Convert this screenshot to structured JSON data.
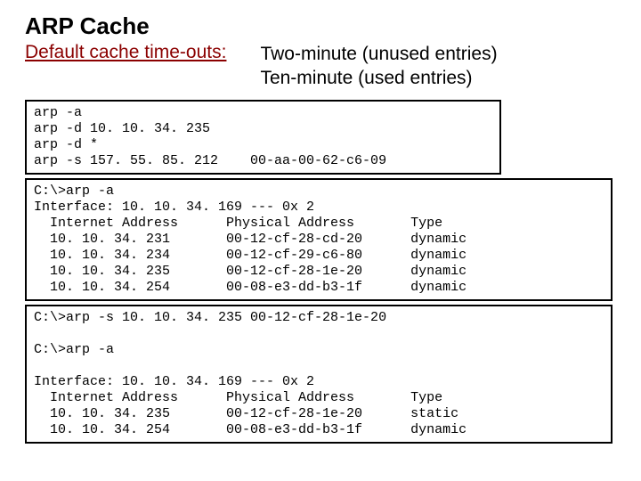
{
  "title": "ARP Cache",
  "subhead": "Default cache time-outs:",
  "timeouts": {
    "line1": "Two-minute (unused entries)",
    "line2": "Ten-minute (used entries)"
  },
  "block1": "arp -a\narp -d 10. 10. 34. 235\narp -d *\narp -s 157. 55. 85. 212    00-aa-00-62-c6-09",
  "block2": "C:\\>arp -a\nInterface: 10. 10. 34. 169 --- 0x 2\n  Internet Address      Physical Address       Type\n  10. 10. 34. 231       00-12-cf-28-cd-20      dynamic\n  10. 10. 34. 234       00-12-cf-29-c6-80      dynamic\n  10. 10. 34. 235       00-12-cf-28-1e-20      dynamic\n  10. 10. 34. 254       00-08-e3-dd-b3-1f      dynamic",
  "block3": "C:\\>arp -s 10. 10. 34. 235 00-12-cf-28-1e-20\n\nC:\\>arp -a\n\nInterface: 10. 10. 34. 169 --- 0x 2\n  Internet Address      Physical Address       Type\n  10. 10. 34. 235       00-12-cf-28-1e-20      static\n  10. 10. 34. 254       00-08-e3-dd-b3-1f      dynamic"
}
